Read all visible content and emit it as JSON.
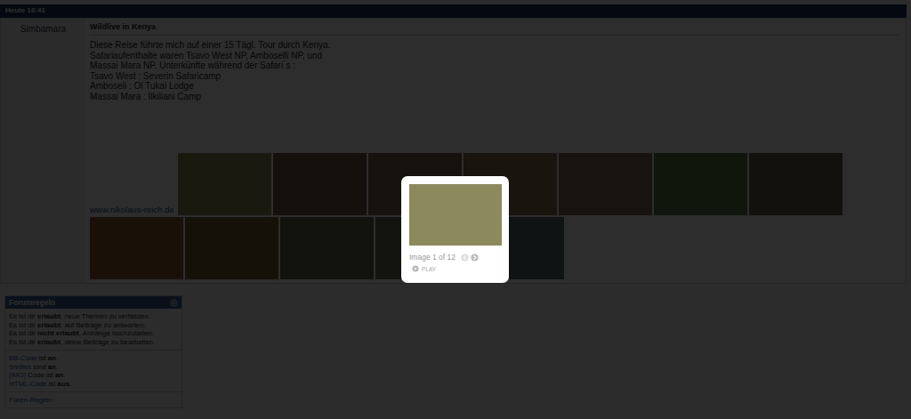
{
  "header": {
    "time": "Heute 16:41"
  },
  "post": {
    "author": "Simbamara",
    "title": "Wildlive in Kenya",
    "lines": [
      "Diese Reise führte mich auf einer 15 Tägl. Tour durch Kenya.",
      "Safariaufenthalte waren Tsavo West NP, Amboselli NP, und",
      "Massai Mara NP. Unterkünfte während der Safari´s :",
      "Tsavo West : Severin Safaricamp",
      "Amboseli : Ol Tukai Lodge",
      "Massai Mara : Ilkiliani Camp"
    ],
    "link": "www.nikolaus-reich.de",
    "thumbnails": [
      {
        "color": "#8c8a5c",
        "selected": true
      },
      {
        "color": "#6e5c3c",
        "selected": false
      },
      {
        "color": "#7a6a55",
        "selected": false
      },
      {
        "color": "#8c7050",
        "selected": false
      },
      {
        "color": "#7a6a5a",
        "selected": false
      },
      {
        "color": "#5c7a3c",
        "selected": false
      },
      {
        "color": "#6c6250",
        "selected": false
      },
      {
        "color": "#8c6030",
        "selected": false
      },
      {
        "color": "#7c6230",
        "selected": false
      },
      {
        "color": "#6c6a50",
        "selected": false
      },
      {
        "color": "#6a6a5a",
        "selected": false
      },
      {
        "color": "#5c6a6a",
        "selected": false
      }
    ]
  },
  "rules": {
    "title": "Forumregeln",
    "permissions": [
      {
        "before": "Es ist dir ",
        "bold": "erlaubt",
        "after": ", neue Themen zu verfassen."
      },
      {
        "before": "Es ist dir ",
        "bold": "erlaubt",
        "after": ", auf Beiträge zu antworten."
      },
      {
        "before": "Es ist dir ",
        "bold": "nicht erlaubt",
        "after": ", Anhänge hochzuladen."
      },
      {
        "before": "Es ist dir ",
        "bold": "erlaubt",
        "after": ", deine Beiträge zu bearbeiten."
      }
    ],
    "settings": [
      {
        "link": "BB-Code",
        "middle": " ist ",
        "bold": "an",
        "after": "."
      },
      {
        "link": "Smilies",
        "middle": " sind ",
        "bold": "an",
        "after": "."
      },
      {
        "link": "[IMG]",
        "middle": " Code ist ",
        "bold": "an",
        "after": "."
      },
      {
        "link": "HTML-Code",
        "middle": " ist ",
        "bold": "aus",
        "after": "."
      }
    ],
    "footer_link": "Foren-Regeln"
  },
  "lightbox": {
    "counter": "Image 1 of 12",
    "play": "PLAY"
  }
}
